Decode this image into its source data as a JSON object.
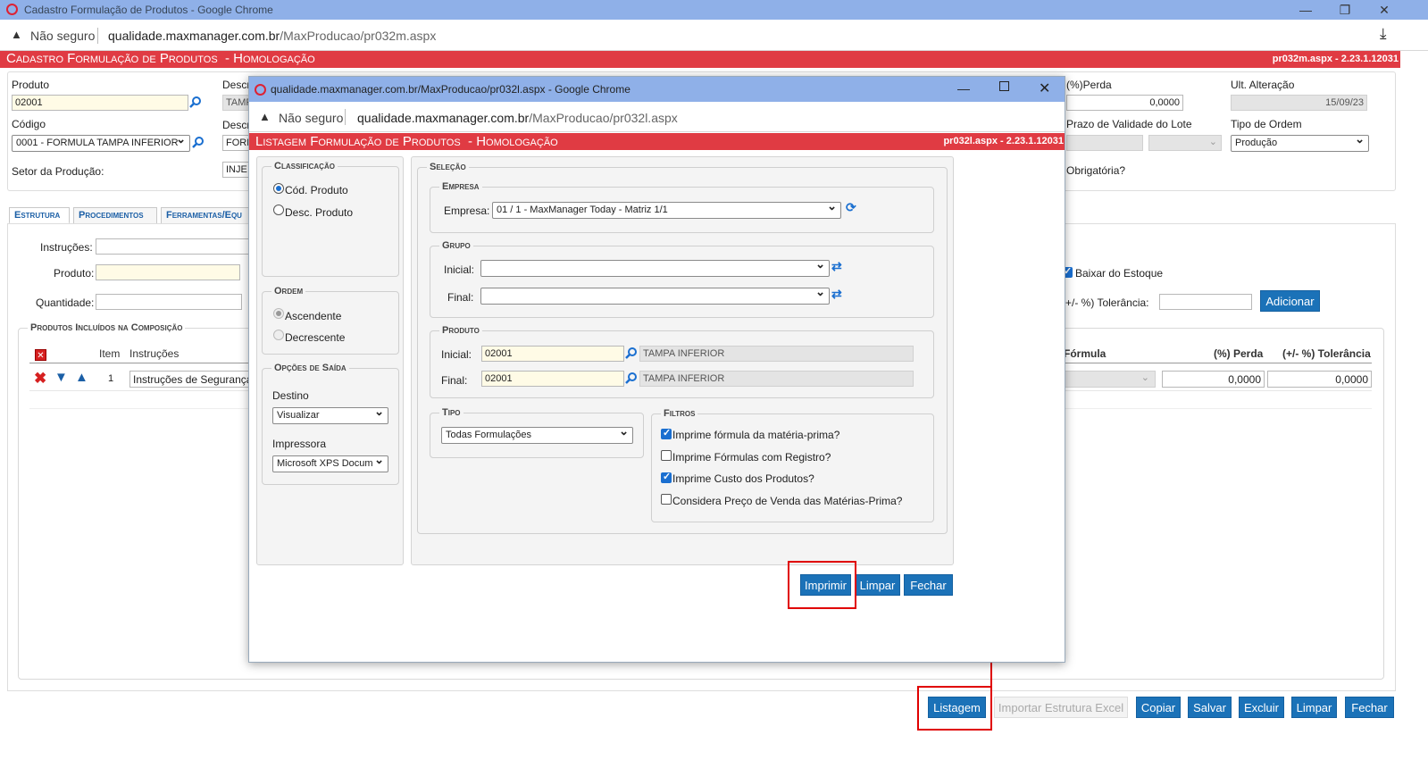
{
  "outer": {
    "window_title": "Cadastro Formulação de Produtos - Google Chrome",
    "not_secure": "Não seguro",
    "url_host": "qualidade.maxmanager.com.br",
    "url_path": "/MaxProducao/pr032m.aspx",
    "header_title": "Cadastro Formulação de Produtos",
    "header_env": "- Homologação",
    "header_version": "pr032m.aspx - 2.23.1.12031",
    "fields": {
      "produto_label": "Produto",
      "produto_value": "02001",
      "descr_label": "Descr",
      "descr_value": "TAMP",
      "codigo_label": "Código",
      "codigo_value": "0001 - FORMULA TAMPA INFERIOR",
      "descr2_label": "Descr",
      "descr2_value": "FORM",
      "setor_label": "Setor da Produção:",
      "setor_value": "INJE",
      "perda_label": "(%)Perda",
      "perda_value": "0,0000",
      "ult_alteracao_label": "Ult. Alteração",
      "ult_alteracao_value": "15/09/23",
      "prazo_label": "Prazo de Validade do Lote",
      "tipo_ordem_label": "Tipo de Ordem",
      "tipo_ordem_value": "Produção",
      "obrigatoria_label": "Obrigatória?"
    },
    "tabs": [
      "Estrutura",
      "Procedimentos",
      "Ferramentas/Equ"
    ],
    "estrutura": {
      "instrucoes_label": "Instruções:",
      "produto_label": "Produto:",
      "quantidade_label": "Quantidade:",
      "baixar_estoque_label": "Baixar do Estoque",
      "tolerancia_label": "+/- %) Tolerância:",
      "adicionar_label": "Adicionar",
      "produtos_incluidos_legend": "Produtos Incluídos na Composição",
      "table_headers": [
        "Item",
        "Instruções",
        "Fórmula",
        "(%) Perda",
        "(+/- %) Tolerância"
      ],
      "rows": [
        {
          "item": "1",
          "instrucoes": "Instruções de Segurança",
          "perda": "0,0000",
          "tolerancia": "0,0000"
        }
      ]
    },
    "buttons": {
      "listagem": "Listagem",
      "importar": "Importar Estrutura Excel",
      "copiar": "Copiar",
      "salvar": "Salvar",
      "excluir": "Excluir",
      "limpar": "Limpar",
      "fechar": "Fechar"
    }
  },
  "popup": {
    "window_title": "qualidade.maxmanager.com.br/MaxProducao/pr032l.aspx - Google Chrome",
    "not_secure": "Não seguro",
    "url_host": "qualidade.maxmanager.com.br",
    "url_path": "/MaxProducao/pr032l.aspx",
    "header_title": "Listagem Formulação de Produtos",
    "header_env": "- Homologação",
    "header_version": "pr032l.aspx - 2.23.1.12031",
    "classificacao": {
      "legend": "Classificação",
      "options": [
        "Cód. Produto",
        "Desc. Produto"
      ]
    },
    "ordem": {
      "legend": "Ordem",
      "options": [
        "Ascendente",
        "Decrescente"
      ]
    },
    "opcoes_saida": {
      "legend": "Opções de Saída",
      "destino_label": "Destino",
      "destino_value": "Visualizar",
      "impressora_label": "Impressora",
      "impressora_value": "Microsoft XPS Docum"
    },
    "selecao": {
      "legend": "Seleção",
      "empresa_legend": "Empresa",
      "empresa_label": "Empresa:",
      "empresa_value": "01 / 1 - MaxManager Today - Matriz 1/1",
      "grupo_legend": "Grupo",
      "inicial_label": "Inicial:",
      "final_label": "Final:",
      "produto_legend": "Produto",
      "produto_inicial_code": "02001",
      "produto_inicial_desc": "TAMPA INFERIOR",
      "produto_final_code": "02001",
      "produto_final_desc": "TAMPA INFERIOR",
      "tipo_legend": "Tipo",
      "tipo_value": "Todas Formulações",
      "filtros_legend": "Filtros",
      "filtros": [
        {
          "label": "Imprime fórmula da matéria-prima?",
          "checked": true
        },
        {
          "label": "Imprime Fórmulas com Registro?",
          "checked": false
        },
        {
          "label": "Imprime Custo dos Produtos?",
          "checked": true
        },
        {
          "label": "Considera Preço de Venda das Matérias-Prima?",
          "checked": false
        }
      ]
    },
    "buttons": {
      "imprimir": "Imprimir",
      "limpar": "Limpar",
      "fechar": "Fechar"
    }
  },
  "colors": {
    "red_header": "#e03b43",
    "titlebar": "#8fb0e8",
    "button_blue": "#1b72b8",
    "annotation_red": "#e00000"
  }
}
